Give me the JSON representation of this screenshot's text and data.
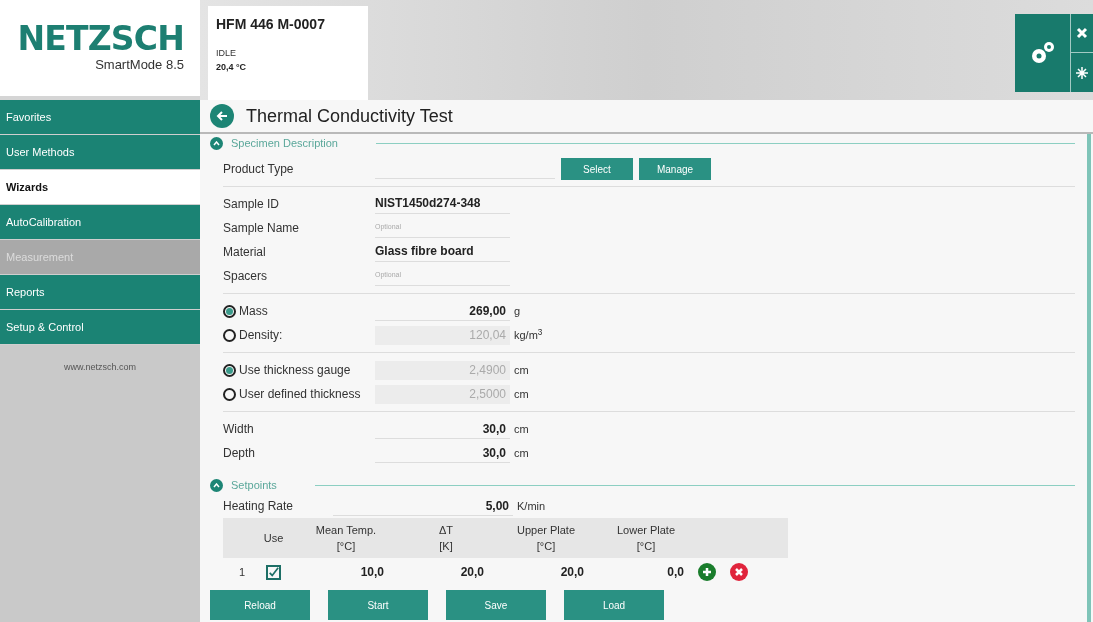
{
  "logo": {
    "brand": "NETZSCH",
    "product": "SmartMode 8.5"
  },
  "device": {
    "name": "HFM 446 M-0007",
    "state": "IDLE",
    "temperature": "20,4 °C"
  },
  "sidebar": {
    "items": [
      {
        "label": "Favorites",
        "selected": false,
        "disabled": false
      },
      {
        "label": "User Methods",
        "selected": false,
        "disabled": false
      },
      {
        "label": "Wizards",
        "selected": true,
        "disabled": false
      },
      {
        "label": "AutoCalibration",
        "selected": false,
        "disabled": false
      },
      {
        "label": "Measurement",
        "selected": false,
        "disabled": true
      },
      {
        "label": "Reports",
        "selected": false,
        "disabled": false
      },
      {
        "label": "Setup & Control",
        "selected": false,
        "disabled": false
      }
    ],
    "footer": "www.netzsch.com"
  },
  "page": {
    "title": "Thermal Conductivity Test"
  },
  "specimen": {
    "title": "Specimen Description",
    "expanded": true,
    "groups": [
      [
        {
          "kind": "select",
          "label": "Product Type",
          "buttons": [
            "Select",
            "Manage"
          ]
        }
      ],
      [
        {
          "kind": "text",
          "label": "Sample ID",
          "value": "NIST1450d274-348"
        },
        {
          "kind": "text",
          "label": "Sample Name",
          "placeholder": "Optional"
        },
        {
          "kind": "text",
          "label": "Material",
          "value": "Glass fibre board"
        },
        {
          "kind": "text",
          "label": "Spacers",
          "placeholder": "Optional"
        }
      ],
      [
        {
          "kind": "radio",
          "label": "Mass",
          "selected": true,
          "value": "269,00",
          "unit": "g",
          "disabled": false
        },
        {
          "kind": "radio",
          "label": "Density:",
          "selected": false,
          "value": "120,04",
          "unit": "kg/m$^{3}$",
          "disabled": true
        }
      ],
      [
        {
          "kind": "radio",
          "label": "Use thickness gauge",
          "selected": true,
          "value": "2,4900",
          "unit": "cm",
          "disabled": true
        },
        {
          "kind": "radio",
          "label": "User defined thickness",
          "selected": false,
          "value": "2,5000",
          "unit": "cm",
          "disabled": true
        }
      ],
      [
        {
          "kind": "number",
          "label": "Width",
          "value": "30,0",
          "unit": "cm"
        },
        {
          "kind": "number",
          "label": "Depth",
          "value": "30,0",
          "unit": "cm"
        }
      ]
    ]
  },
  "setpoints": {
    "title": "Setpoints",
    "expanded": true,
    "heating_rate": {
      "label": "Heating Rate",
      "value": "5,00",
      "unit": "K/min"
    },
    "use_column": {
      "label": "Use"
    },
    "columns": [
      {
        "label": "Mean Temp.",
        "unit": "[°C]"
      },
      {
        "label": "ΔT",
        "unit": "[K]"
      },
      {
        "label": "Upper Plate",
        "unit": "[°C]"
      },
      {
        "label": "Lower Plate",
        "unit": "[°C]"
      }
    ],
    "rows": [
      {
        "index": "1",
        "checked": true,
        "cells": [
          "10,0",
          "20,0",
          "20,0",
          "0,0"
        ]
      }
    ]
  },
  "actions": [
    "Reload",
    "Start",
    "Save",
    "Load"
  ]
}
